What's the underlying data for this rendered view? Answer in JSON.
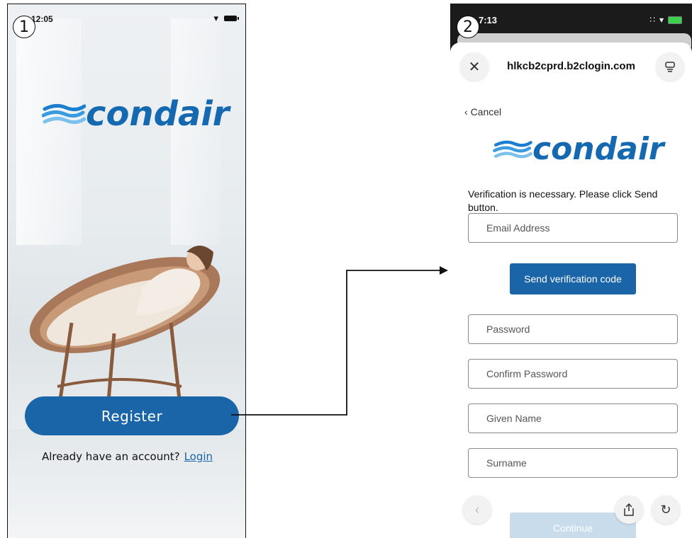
{
  "screen1": {
    "step_number": "1",
    "status_time": "12:05",
    "logo_text": "condair",
    "register_label": "Register",
    "login_prompt": "Already have an account?",
    "login_link": "Login"
  },
  "screen2": {
    "step_number": "2",
    "status_time": "7:13",
    "url": "hlkcb2cprd.b2clogin.com",
    "cancel_label": "Cancel",
    "logo_text": "condair",
    "verify_message": "Verification is necessary. Please click Send button.",
    "email_placeholder": "Email Address",
    "send_code_label": "Send verification code",
    "password_placeholder": "Password",
    "confirm_password_placeholder": "Confirm Password",
    "given_name_placeholder": "Given Name",
    "surname_placeholder": "Surname",
    "continue_label": "Continue"
  },
  "icons": {
    "close": "close-icon",
    "reader": "reader-icon",
    "back": "chevron-left-icon",
    "share": "share-icon",
    "reload": "reload-icon",
    "wifi": "wifi-icon",
    "battery": "battery-icon"
  },
  "colors": {
    "brand_blue": "#1a64a8",
    "continue_disabled": "#c9dcec",
    "battery_charging": "#3bd14a"
  }
}
